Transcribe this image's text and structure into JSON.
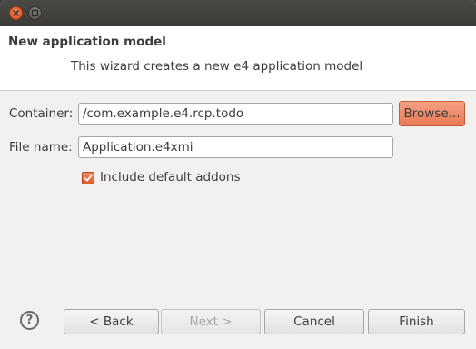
{
  "dialog": {
    "title": "New application model",
    "description": "This wizard creates a new e4 application model"
  },
  "form": {
    "container_label": "Container:",
    "container_value": "/com.example.e4.rcp.todo",
    "browse_label": "Browse...",
    "filename_label": "File name:",
    "filename_value": "Application.e4xmi",
    "include_addons_label": "Include default addons",
    "include_addons_checked": true
  },
  "footer": {
    "help_symbol": "?",
    "back_label": "< Back",
    "next_label": "Next >",
    "cancel_label": "Cancel",
    "finish_label": "Finish"
  },
  "colors": {
    "accent": "#e9744b",
    "titlebar": "#3c3b37",
    "dialog_bg": "#f2f1f0"
  },
  "icons": [
    "close-icon",
    "minimize-icon",
    "checkmark-icon",
    "help-icon"
  ]
}
